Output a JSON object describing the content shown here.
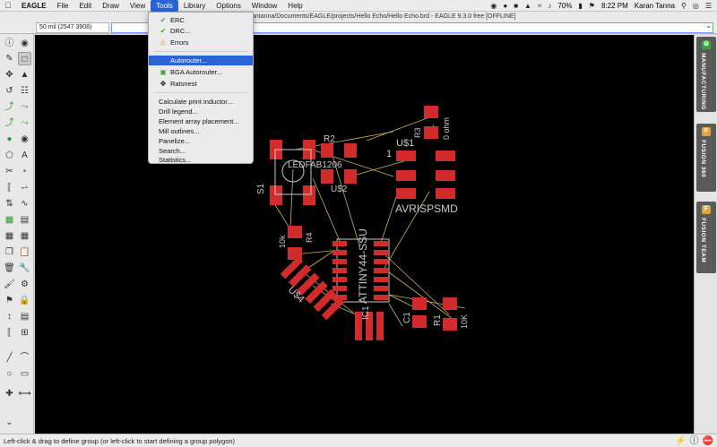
{
  "menubar": {
    "items": [
      "EAGLE",
      "File",
      "Edit",
      "Draw",
      "View",
      "Tools",
      "Library",
      "Options",
      "Window",
      "Help"
    ],
    "active_index": 5,
    "status": {
      "battery": "70%",
      "clock": "8:22 PM",
      "user": "Karan Tanna"
    }
  },
  "window": {
    "title": "antanna/Documents/EAGLE/projects/Hello Echo/Hello Echo.brd - EAGLE 9.3.0 free [OFFLINE]"
  },
  "coordinate": {
    "value": "50 mil (2547 3908)"
  },
  "tools_menu": {
    "items": [
      {
        "label": "ERC",
        "icon": "check-icon"
      },
      {
        "label": "DRC...",
        "icon": "check-icon"
      },
      {
        "label": "Errors",
        "icon": "warning-icon"
      },
      {
        "label": "Autorouter...",
        "icon": ""
      },
      {
        "label": "BGA Autorouter...",
        "icon": "bga-icon"
      },
      {
        "label": "Ratsnest",
        "icon": "ratsnest-icon"
      },
      {
        "label": "Calculate print inductor...",
        "icon": ""
      },
      {
        "label": "Drill legend...",
        "icon": ""
      },
      {
        "label": "Element array placement...",
        "icon": ""
      },
      {
        "label": "Mill outlines...",
        "icon": ""
      },
      {
        "label": "Panelize...",
        "icon": ""
      },
      {
        "label": "Search...",
        "icon": ""
      },
      {
        "label": "Statistics...",
        "icon": ""
      }
    ],
    "highlighted_index": 3
  },
  "board_labels": {
    "ledfab": "LEDFAB1206",
    "r2": "R2",
    "r3": "R3",
    "ohm": "0 ohm",
    "u1": "U$1",
    "one": "1",
    "u2": "U$2",
    "s1": "S1",
    "avrisp": "AVRISPSMD",
    "attiny": "ATTINY44-SSU",
    "r4": "R4",
    "r4val": "10k",
    "u4": "U$4",
    "ic1": "IC1",
    "c1": "C1",
    "r1": "R1",
    "r1val": "10K"
  },
  "right_panel": {
    "tabs": [
      "MANUFACTURING",
      "FUSION 360",
      "FUSION TEAM"
    ]
  },
  "status_bar": {
    "message": "Left-click & drag to define group (or left-click to start defining a group polygon)"
  },
  "colors": {
    "canvas": "#000000",
    "pad": "#d22b2b",
    "silkscreen": "#c8c8c8",
    "airwire": "#c8b45a",
    "highlight": "#2a63d6"
  }
}
